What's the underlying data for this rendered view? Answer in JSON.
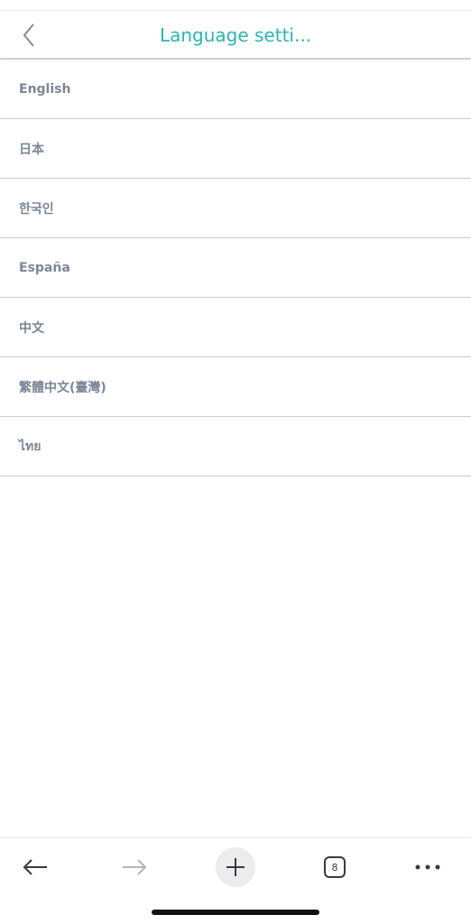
{
  "header": {
    "title": "Language setti..."
  },
  "languages": [
    {
      "label": "English"
    },
    {
      "label": "日本"
    },
    {
      "label": "한국인"
    },
    {
      "label": "España"
    },
    {
      "label": "中文"
    },
    {
      "label": "繁體中文(臺灣)"
    },
    {
      "label": "ไทย"
    }
  ],
  "toolbar": {
    "tab_count": "8",
    "icons": [
      "back-arrow-icon",
      "forward-arrow-icon",
      "plus-icon",
      "tabs-icon",
      "more-icon"
    ]
  },
  "colors": {
    "accent": "#29b5b3",
    "item_text": "#7c8796",
    "divider": "#c4ccd6"
  }
}
